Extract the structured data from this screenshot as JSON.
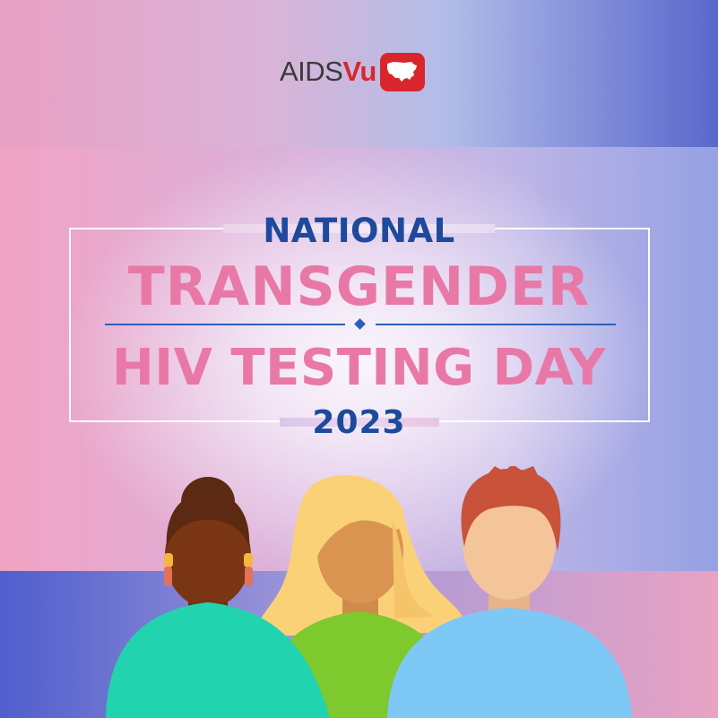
{
  "logo": {
    "text_main": "AIDS",
    "text_accent": "Vu",
    "icon": "us-map-icon"
  },
  "heading": {
    "line1": "NATIONAL",
    "line2": "TRANSGENDER",
    "line3": "HIV TESTING DAY",
    "year": "2023"
  },
  "illustration": {
    "people": [
      "person-left",
      "person-center",
      "person-right"
    ]
  },
  "colors": {
    "navy": "#1d4a9c",
    "pink": "#e879a7",
    "logo_red": "#d8262c",
    "teal_shirt": "#22d3b0",
    "green_shirt": "#7dc92e",
    "blue_shirt": "#7ec8f5"
  }
}
